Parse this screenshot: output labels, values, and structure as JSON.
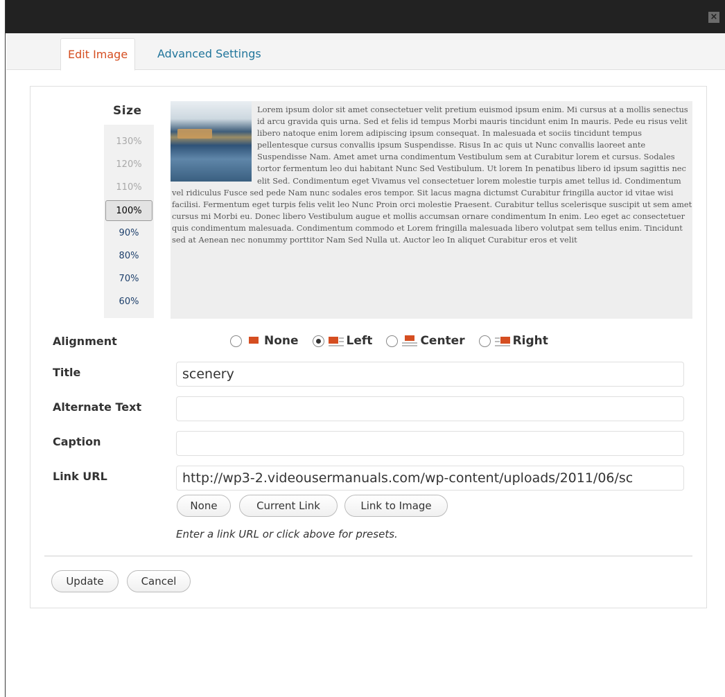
{
  "window": {
    "close_label": "×"
  },
  "tabs": [
    {
      "label": "Edit Image",
      "active": true
    },
    {
      "label": "Advanced Settings",
      "active": false
    }
  ],
  "size": {
    "label": "Size",
    "options": [
      "130%",
      "120%",
      "110%",
      "100%",
      "90%",
      "80%",
      "70%",
      "60%"
    ],
    "selected": "100%"
  },
  "preview": {
    "text": "Lorem ipsum dolor sit amet consectetuer velit pretium euismod ipsum enim. Mi cursus at a mollis senectus id arcu gravida quis urna. Sed et felis id tempus Morbi mauris tincidunt enim In mauris. Pede eu risus velit libero natoque enim lorem adipiscing ipsum consequat. In malesuada et sociis tincidunt tempus pellentesque cursus convallis ipsum Suspendisse. Risus In ac quis ut Nunc convallis laoreet ante Suspendisse Nam. Amet amet urna condimentum Vestibulum sem at Curabitur lorem et cursus. Sodales tortor fermentum leo dui habitant Nunc Sed Vestibulum. Ut lorem In penatibus libero id ipsum sagittis nec elit Sed. Condimentum eget Vivamus vel consectetuer lorem molestie turpis amet tellus id. Condimentum vel ridiculus Fusce sed pede Nam nunc sodales eros tempor. Sit lacus magna dictumst Curabitur fringilla auctor id vitae wisi facilisi. Fermentum eget turpis felis velit leo Nunc Proin orci molestie Praesent. Curabitur tellus scelerisque suscipit ut sem amet cursus mi Morbi eu. Donec libero Vestibulum augue et mollis accumsan ornare condimentum In enim. Leo eget ac consectetuer quis condimentum malesuada. Condimentum commodo et Lorem fringilla malesuada libero volutpat sem tellus enim. Tincidunt sed at Aenean nec nonummy porttitor Nam Sed Nulla ut. Auctor leo In aliquet Curabitur eros et velit"
  },
  "alignment": {
    "label": "Alignment",
    "options": [
      "None",
      "Left",
      "Center",
      "Right"
    ],
    "selected": "Left"
  },
  "title": {
    "label": "Title",
    "value": "scenery"
  },
  "alt_text": {
    "label": "Alternate Text",
    "value": ""
  },
  "caption": {
    "label": "Caption",
    "value": ""
  },
  "link_url": {
    "label": "Link URL",
    "value": "http://wp3-2.videousermanuals.com/wp-content/uploads/2011/06/sc",
    "buttons": [
      "None",
      "Current Link",
      "Link to Image"
    ],
    "hint": "Enter a link URL or click above for presets."
  },
  "actions": {
    "update": "Update",
    "cancel": "Cancel"
  },
  "colors": {
    "active_tab": "#d54e21",
    "link": "#21759b",
    "titlebar": "#222222"
  }
}
